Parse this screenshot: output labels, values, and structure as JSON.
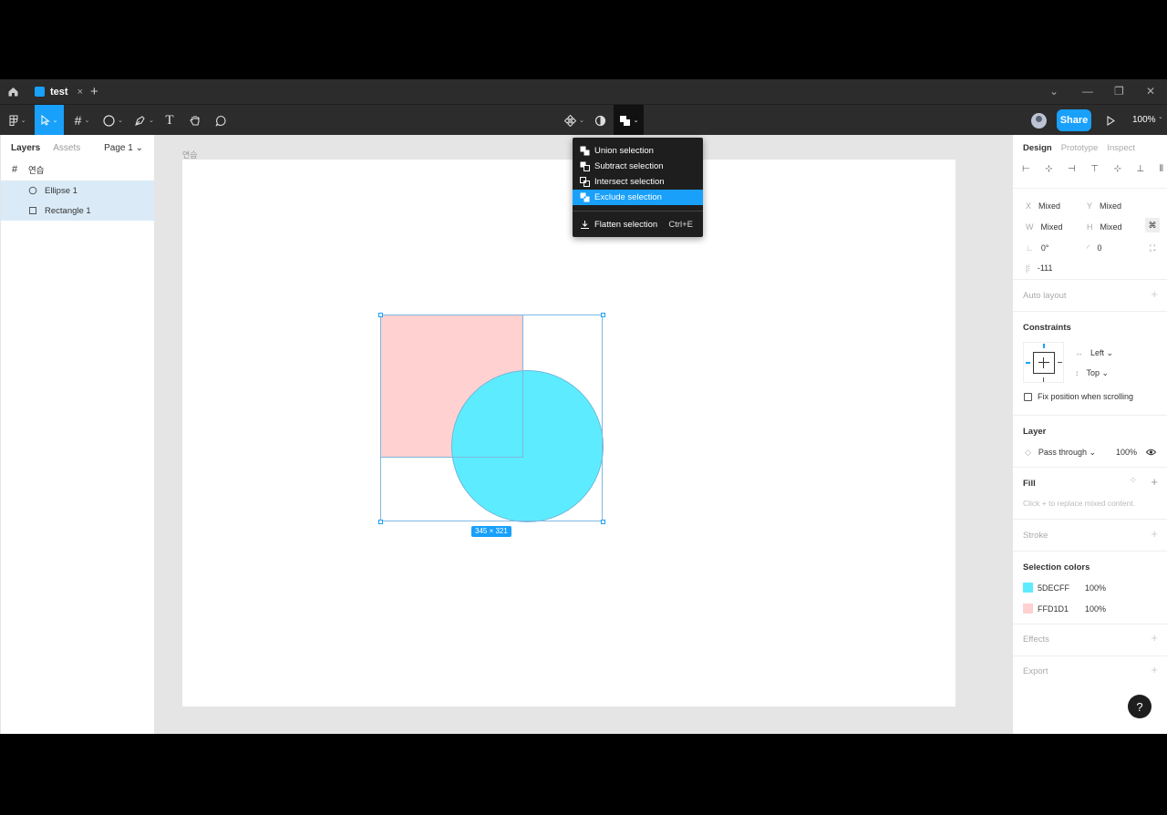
{
  "tabbar": {
    "file_tab": "test",
    "close_glyph": "×",
    "new_tab_glyph": "+"
  },
  "toolbar": {
    "share_label": "Share",
    "zoom": "100%",
    "caret": "⌄",
    "accent": "#18a0fb"
  },
  "left_panel": {
    "tab_layers": "Layers",
    "tab_assets": "Assets",
    "page_selector": "Page 1 ⌄",
    "layers": [
      {
        "label": "연습",
        "icon": "frame-icon",
        "selected": false
      },
      {
        "label": "Ellipse 1",
        "icon": "ellipse-icon",
        "selected": true
      },
      {
        "label": "Rectangle 1",
        "icon": "rectangle-icon",
        "selected": true
      }
    ]
  },
  "canvas": {
    "frame_label": "연습",
    "dimensions_badge": "345 × 321"
  },
  "boolean_menu": {
    "items": [
      {
        "label": "Union selection",
        "icon": "union-icon",
        "highlighted": false
      },
      {
        "label": "Subtract selection",
        "icon": "subtract-icon",
        "highlighted": false
      },
      {
        "label": "Intersect selection",
        "icon": "intersect-icon",
        "highlighted": false
      },
      {
        "label": "Exclude selection",
        "icon": "exclude-icon",
        "highlighted": true
      }
    ],
    "flatten": {
      "label": "Flatten selection",
      "shortcut": "Ctrl+E",
      "icon": "flatten-icon"
    }
  },
  "right_panel": {
    "tabs": [
      "Design",
      "Prototype",
      "Inspect"
    ],
    "x_label": "X",
    "x_value": "Mixed",
    "y_label": "Y",
    "y_value": "Mixed",
    "w_label": "W",
    "w_value": "Mixed",
    "h_label": "H",
    "h_value": "Mixed",
    "rotation": "0°",
    "radius": "0",
    "spacing": "-111",
    "auto_layout": "Auto layout",
    "constraints_title": "Constraints",
    "constraint_h": "Left ⌄",
    "constraint_v": "Top ⌄",
    "fix_position": "Fix position when scrolling",
    "layer_title": "Layer",
    "blend_mode": "Pass through ⌄",
    "layer_opacity": "100%",
    "fill_title": "Fill",
    "fill_hint": "Click + to replace mixed content.",
    "stroke_title": "Stroke",
    "selection_colors_title": "Selection colors",
    "colors": [
      {
        "hex": "5DECFF",
        "opacity": "100%",
        "swatch": "#5decff"
      },
      {
        "hex": "FFD1D1",
        "opacity": "100%",
        "swatch": "#ffd1d1"
      }
    ],
    "effects_title": "Effects",
    "export_title": "Export",
    "help_glyph": "?"
  }
}
